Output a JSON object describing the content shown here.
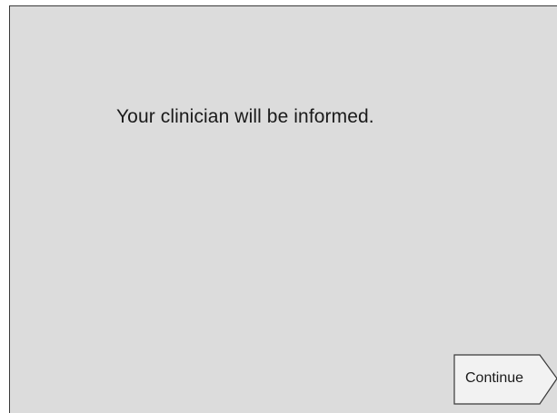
{
  "screen": {
    "message": "Your clinician will be informed."
  },
  "footer": {
    "continue_label": "Continue"
  },
  "colors": {
    "background": "#dcdcdc",
    "button_face": "#f2f2f2",
    "text": "#1a1a1a"
  },
  "icons": {
    "continue_button_shape": "arrow-right-pointer"
  }
}
